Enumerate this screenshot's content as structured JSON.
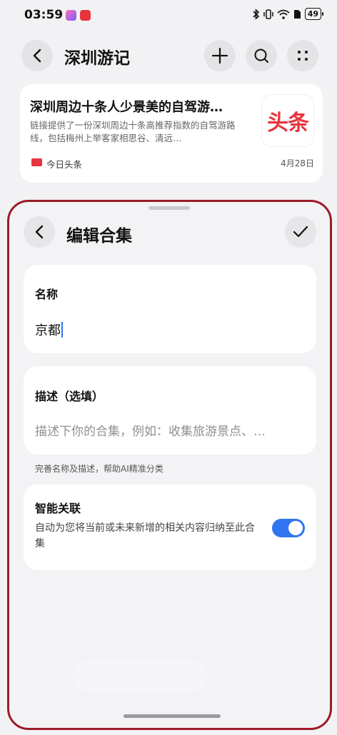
{
  "status_bar": {
    "time": "03:59",
    "battery": "49",
    "icons": [
      "bluetooth-icon",
      "vibrate-icon",
      "wifi-icon",
      "sim-icon",
      "battery-icon"
    ]
  },
  "header": {
    "title": "深圳游记"
  },
  "article": {
    "title": "深圳周边十条人少景美的自驾游…",
    "desc": "链接提供了一份深圳周边十条高推荐指数的自驾游路线，包括梅州上举客家相思谷、清远…",
    "thumb_text": "头条",
    "source": "今日头条",
    "date": "4月28日"
  },
  "sheet": {
    "title": "编辑合集",
    "name_label": "名称",
    "name_value": "京都",
    "desc_label": "描述（选填）",
    "desc_placeholder": "描述下你的合集，例如：收集旅游景点、…",
    "hint": "完善名称及描述，帮助AI精准分类",
    "smart_title": "智能关联",
    "smart_desc": "自动为您将当前或未来新增的相关内容归纳至此合集",
    "smart_enabled": true
  },
  "colors": {
    "accent": "#2f74f0",
    "sheet_border": "#9c1b28",
    "toutiao_red": "#e8343c"
  }
}
